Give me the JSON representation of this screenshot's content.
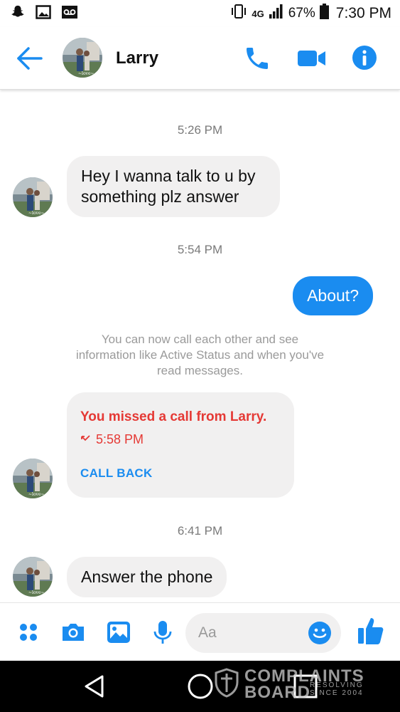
{
  "status_bar": {
    "network": "4G",
    "battery_percent": "67%",
    "time": "7:30 PM",
    "icons": [
      "snapchat-icon",
      "gallery-icon",
      "voicemail-icon",
      "vibrate-icon",
      "signal-icon",
      "battery-icon"
    ]
  },
  "header": {
    "contact_name": "Larry",
    "icons": [
      "back-arrow-icon",
      "phone-icon",
      "video-icon",
      "info-icon"
    ],
    "accent_color": "#1a8cf0"
  },
  "chat": {
    "timestamp_1": "5:26 PM",
    "message_1": "Hey I wanna talk to u by something plz answer",
    "timestamp_2": "5:54 PM",
    "message_2": "About?",
    "system_notice": "You can now call each other and see information like Active Status and when you've read messages.",
    "missed_call": {
      "title": "You missed a call from Larry.",
      "time": "5:58 PM",
      "action": "CALL BACK",
      "color": "#e53935"
    },
    "timestamp_3": "6:41 PM",
    "message_3": "Answer the phone"
  },
  "composer": {
    "placeholder": "Aa",
    "icons": [
      "apps-icon",
      "camera-icon",
      "image-icon",
      "microphone-icon",
      "emoji-icon",
      "thumbs-up-icon"
    ]
  },
  "nav_bar": {
    "icons": [
      "back-triangle-icon",
      "home-circle-icon",
      "recents-square-icon"
    ]
  },
  "watermark": {
    "line1": "COMPLAINTS",
    "line2": "BOARD",
    "tagline1": "RESOLVING",
    "tagline2": "SINCE 2004"
  }
}
